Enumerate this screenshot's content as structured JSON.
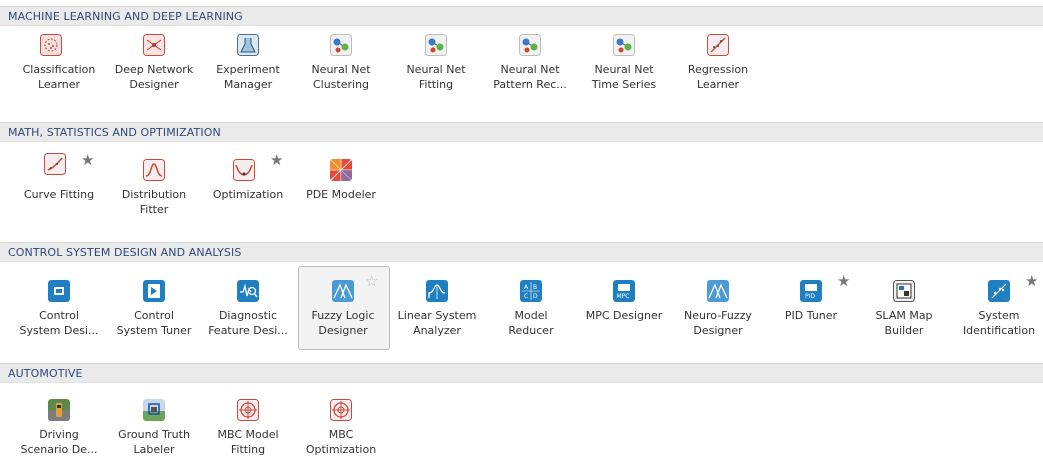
{
  "sections": [
    {
      "title": "MACHINE LEARNING AND DEEP LEARNING",
      "apps": [
        {
          "line1": "Classification",
          "line2": "Learner",
          "icon": "classification-learner-icon",
          "star": ""
        },
        {
          "line1": "Deep Network",
          "line2": "Designer",
          "icon": "deep-network-designer-icon",
          "star": ""
        },
        {
          "line1": "Experiment",
          "line2": "Manager",
          "icon": "experiment-manager-icon",
          "star": ""
        },
        {
          "line1": "Neural Net",
          "line2": "Clustering",
          "icon": "neural-net-icon",
          "star": ""
        },
        {
          "line1": "Neural Net",
          "line2": "Fitting",
          "icon": "neural-net-icon",
          "star": ""
        },
        {
          "line1": "Neural Net",
          "line2": "Pattern Rec...",
          "icon": "neural-net-icon",
          "star": ""
        },
        {
          "line1": "Neural Net",
          "line2": "Time Series",
          "icon": "neural-net-icon",
          "star": ""
        },
        {
          "line1": "Regression",
          "line2": "Learner",
          "icon": "regression-learner-icon",
          "star": ""
        }
      ]
    },
    {
      "title": "MATH, STATISTICS AND OPTIMIZATION",
      "apps": [
        {
          "line1": "Curve Fitting",
          "line2": "",
          "icon": "curve-fitting-icon",
          "star": "★"
        },
        {
          "line1": "Distribution",
          "line2": "Fitter",
          "icon": "distribution-fitter-icon",
          "star": ""
        },
        {
          "line1": "Optimization",
          "line2": "",
          "icon": "optimization-icon",
          "star": "★"
        },
        {
          "line1": "PDE Modeler",
          "line2": "",
          "icon": "pde-modeler-icon",
          "star": ""
        }
      ]
    },
    {
      "title": "CONTROL SYSTEM DESIGN AND ANALYSIS",
      "apps": [
        {
          "line1": "Control",
          "line2": "System Desi...",
          "icon": "control-system-designer-icon",
          "star": ""
        },
        {
          "line1": "Control",
          "line2": "System Tuner",
          "icon": "control-system-tuner-icon",
          "star": ""
        },
        {
          "line1": "Diagnostic",
          "line2": "Feature Desi...",
          "icon": "diagnostic-feature-designer-icon",
          "star": ""
        },
        {
          "line1": "Fuzzy Logic",
          "line2": "Designer",
          "icon": "fuzzy-logic-designer-icon",
          "star": "☆"
        },
        {
          "line1": "Linear System",
          "line2": "Analyzer",
          "icon": "linear-system-analyzer-icon",
          "star": ""
        },
        {
          "line1": "Model",
          "line2": "Reducer",
          "icon": "model-reducer-icon",
          "star": ""
        },
        {
          "line1": "MPC Designer",
          "line2": "",
          "icon": "mpc-designer-icon",
          "star": ""
        },
        {
          "line1": "Neuro-Fuzzy",
          "line2": "Designer",
          "icon": "neuro-fuzzy-designer-icon",
          "star": ""
        },
        {
          "line1": "PID Tuner",
          "line2": "",
          "icon": "pid-tuner-icon",
          "star": "★"
        },
        {
          "line1": "SLAM Map",
          "line2": "Builder",
          "icon": "slam-map-builder-icon",
          "star": ""
        },
        {
          "line1": "System",
          "line2": "Identification",
          "icon": "system-identification-icon",
          "star": "★"
        }
      ]
    },
    {
      "title": "AUTOMOTIVE",
      "apps": [
        {
          "line1": "Driving",
          "line2": "Scenario De...",
          "icon": "driving-scenario-designer-icon",
          "star": ""
        },
        {
          "line1": "Ground Truth",
          "line2": "Labeler",
          "icon": "ground-truth-labeler-icon",
          "star": ""
        },
        {
          "line1": "MBC Model",
          "line2": "Fitting",
          "icon": "mbc-icon",
          "star": ""
        },
        {
          "line1": "MBC",
          "line2": "Optimization",
          "icon": "mbc-icon",
          "star": ""
        }
      ]
    }
  ],
  "icon_text": {
    "model_reducer_letters": "A B C D",
    "mpc": "MPC",
    "pid": "PID"
  }
}
